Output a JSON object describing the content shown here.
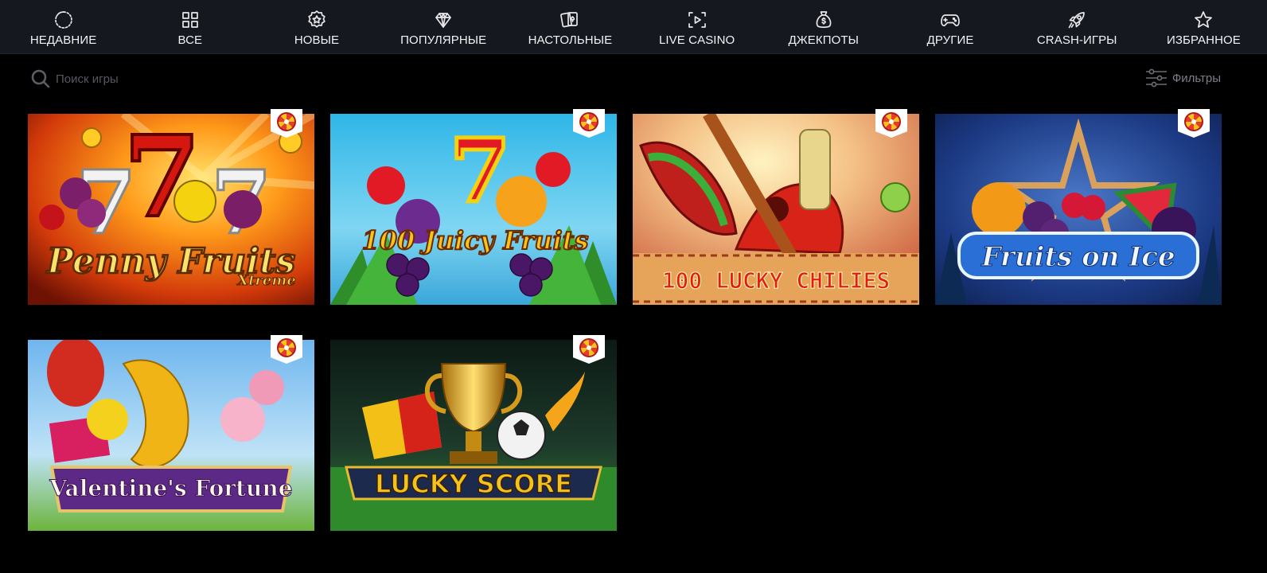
{
  "nav": {
    "items": [
      {
        "label": "НЕДАВНИЕ",
        "icon": "recent-icon"
      },
      {
        "label": "ВСЕ",
        "icon": "grid-icon"
      },
      {
        "label": "НОВЫЕ",
        "icon": "new-badge-icon"
      },
      {
        "label": "ПОПУЛЯРНЫЕ",
        "icon": "diamond-icon"
      },
      {
        "label": "НАСТОЛЬНЫЕ",
        "icon": "cards-icon"
      },
      {
        "label": "LIVE CASINO",
        "icon": "live-video-icon"
      },
      {
        "label": "ДЖЕКПОТЫ",
        "icon": "money-bag-icon"
      },
      {
        "label": "ДРУГИЕ",
        "icon": "gamepad-icon"
      },
      {
        "label": "CRASH-ИГРЫ",
        "icon": "rocket-icon"
      },
      {
        "label": "ИЗБРАННОЕ",
        "icon": "star-icon"
      }
    ]
  },
  "search": {
    "placeholder": "Поиск игры",
    "value": "",
    "icon": "search-icon"
  },
  "filters": {
    "label": "Фильтры",
    "icon": "sliders-icon"
  },
  "games": [
    {
      "title": "Penny Fruits",
      "subtitle": "Xtreme",
      "badge": "wheel-badge-icon"
    },
    {
      "title": "100 Juicy Fruits",
      "subtitle": "",
      "badge": "wheel-badge-icon"
    },
    {
      "title": "100 LUCKY CHILIES",
      "subtitle": "",
      "badge": "wheel-badge-icon"
    },
    {
      "title": "Fruits on Ice",
      "subtitle": "",
      "badge": "wheel-badge-icon"
    },
    {
      "title": "Valentine's Fortune",
      "subtitle": "",
      "badge": "wheel-badge-icon"
    },
    {
      "title": "LUCKY SCORE",
      "subtitle": "",
      "badge": "wheel-badge-icon"
    }
  ],
  "colors": {
    "nav_bg": "#16181f",
    "page_bg": "#000000",
    "text_primary": "#f2f2f4",
    "text_muted": "#55585f"
  }
}
